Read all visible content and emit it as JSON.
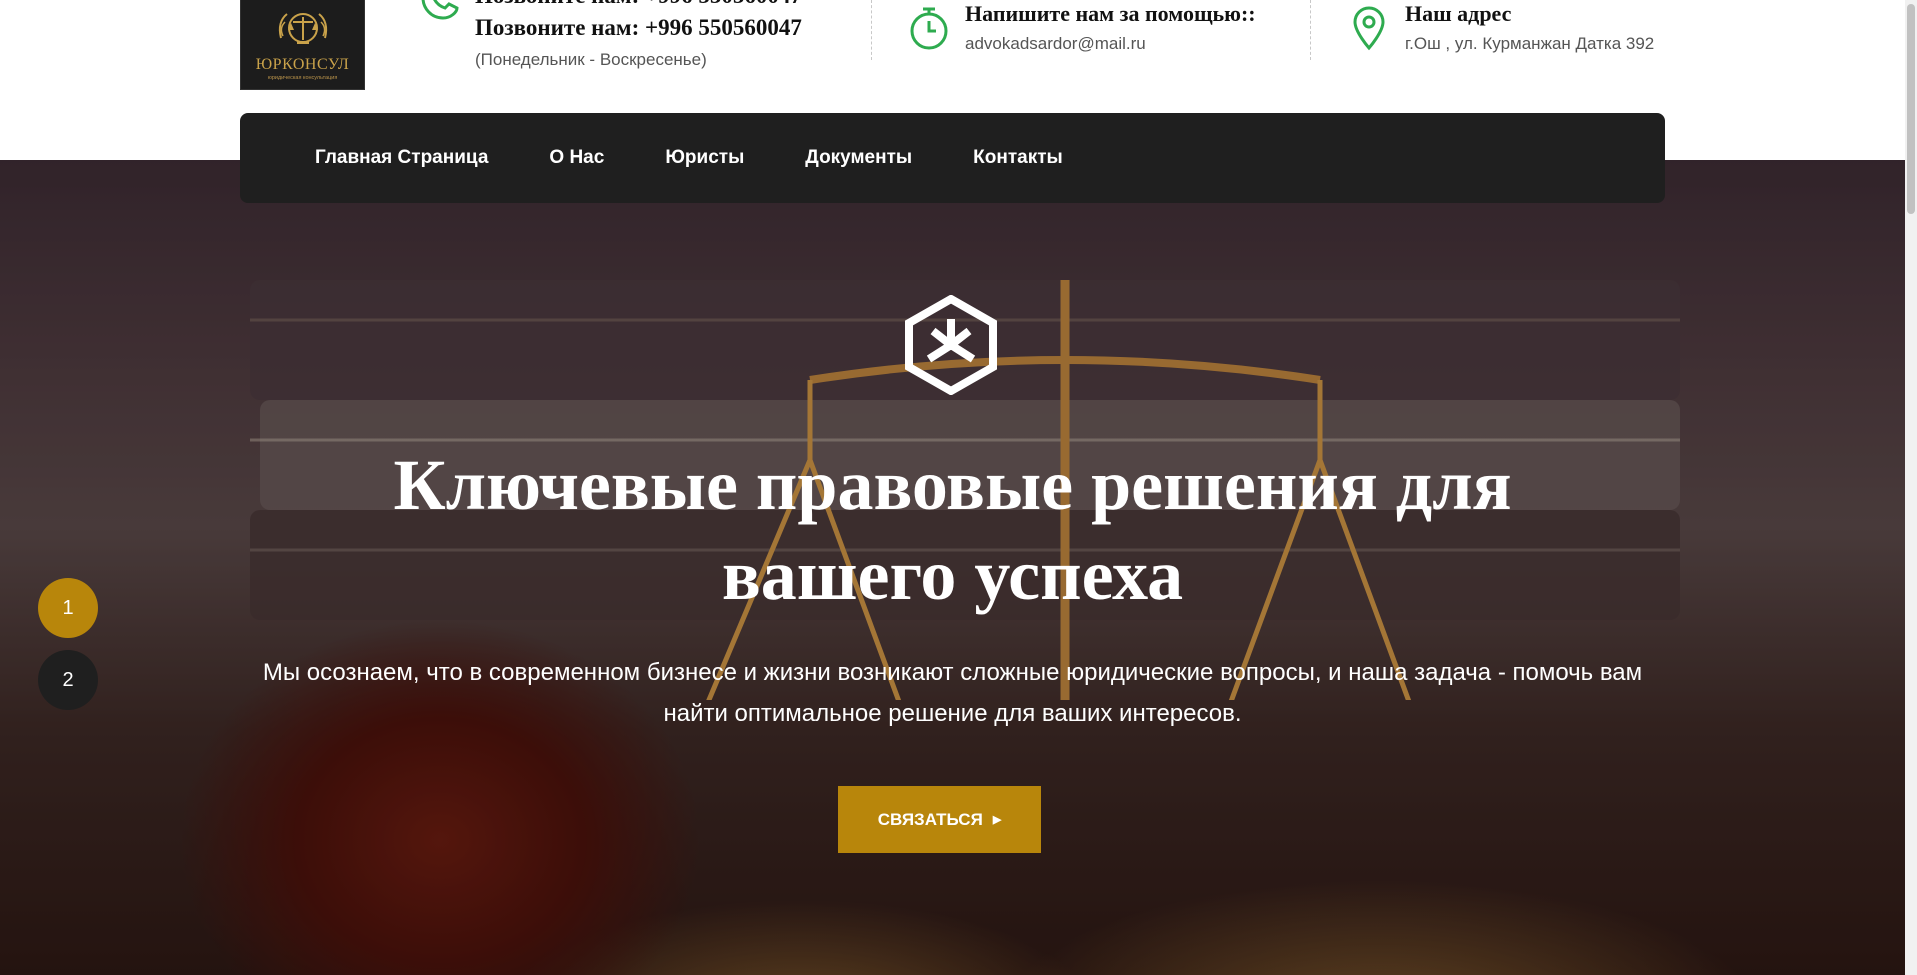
{
  "header": {
    "logo": {
      "name": "ЮРКОНСУЛ",
      "subtitle": "юридическая консультация"
    },
    "phone": {
      "title": "Позвоните нам: +996 550560047",
      "title_partial": "Позвоните нам: +996 550560047",
      "hours": "(Понедельник - Воскресенье)"
    },
    "email": {
      "title": "Напишите нам за помощью::",
      "value": "advokadsardor@mail.ru"
    },
    "address": {
      "title": "Наш адрес",
      "value": "г.Ош , ул. Курманжан Датка 392"
    }
  },
  "nav": {
    "items": [
      "Главная Страница",
      "О Нас",
      "Юристы",
      "Документы",
      "Контакты"
    ]
  },
  "hero": {
    "title": "Ключевые правовые решения для вашего успеха",
    "text": "Мы осознаем, что в современном бизнесе и жизни возникают сложные юридические вопросы, и наша задача - помочь вам найти оптимальное решение для ваших интересов.",
    "cta_label": "СВЯЗАТЬСЯ",
    "slides": [
      "1",
      "2"
    ]
  },
  "colors": {
    "accent": "#b8860b",
    "icon_green": "#2eab4f",
    "nav_bg": "#1f1f1f"
  }
}
